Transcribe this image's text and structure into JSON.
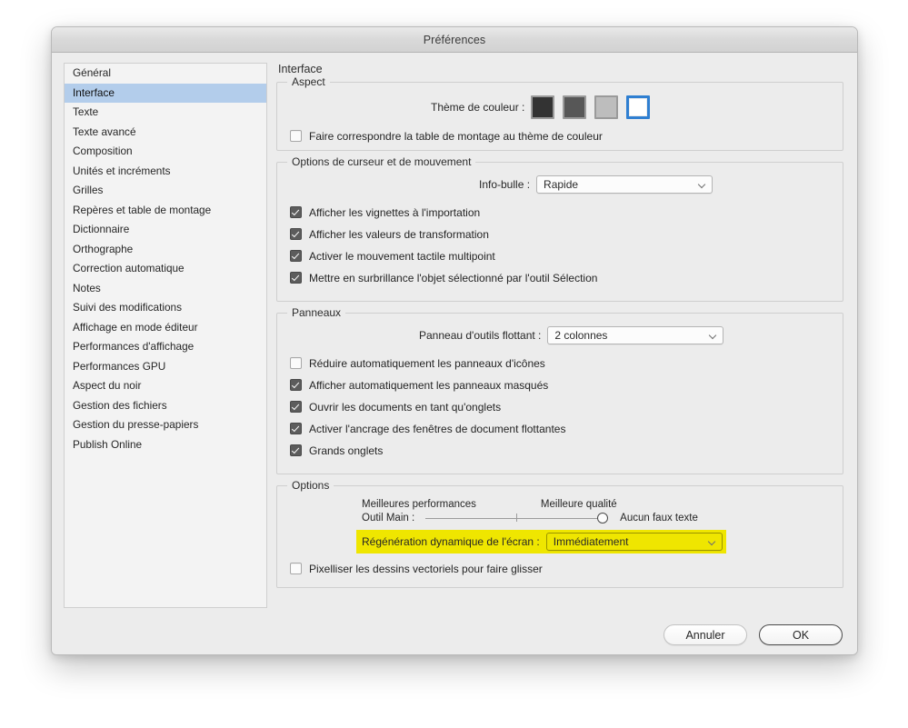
{
  "window": {
    "title": "Préférences"
  },
  "sidebar": {
    "items": [
      {
        "label": "Général",
        "selected": false
      },
      {
        "label": "Interface",
        "selected": true
      },
      {
        "label": "Texte",
        "selected": false
      },
      {
        "label": "Texte avancé",
        "selected": false
      },
      {
        "label": "Composition",
        "selected": false
      },
      {
        "label": "Unités et incréments",
        "selected": false
      },
      {
        "label": "Grilles",
        "selected": false
      },
      {
        "label": "Repères et table de montage",
        "selected": false
      },
      {
        "label": "Dictionnaire",
        "selected": false
      },
      {
        "label": "Orthographe",
        "selected": false
      },
      {
        "label": "Correction automatique",
        "selected": false
      },
      {
        "label": "Notes",
        "selected": false
      },
      {
        "label": "Suivi des modifications",
        "selected": false
      },
      {
        "label": "Affichage en mode éditeur",
        "selected": false
      },
      {
        "label": "Performances d'affichage",
        "selected": false
      },
      {
        "label": "Performances GPU",
        "selected": false
      },
      {
        "label": "Aspect du noir",
        "selected": false
      },
      {
        "label": "Gestion des fichiers",
        "selected": false
      },
      {
        "label": "Gestion du presse-papiers",
        "selected": false
      },
      {
        "label": "Publish Online",
        "selected": false
      }
    ]
  },
  "pane": {
    "title": "Interface",
    "aspect": {
      "legend": "Aspect",
      "theme_label": "Thème de couleur :",
      "swatches": [
        {
          "name": "dark-theme-swatch",
          "color": "#333333",
          "selected": false
        },
        {
          "name": "medium-dark-theme-swatch",
          "color": "#575757",
          "selected": false
        },
        {
          "name": "light-grey-theme-swatch",
          "color": "#bdbdbd",
          "selected": false
        },
        {
          "name": "light-theme-swatch",
          "color": "#ffffff",
          "selected": true
        }
      ],
      "match_pasteboard_label": "Faire correspondre la table de montage au thème de couleur",
      "match_pasteboard_checked": false
    },
    "cursor": {
      "legend": "Options de curseur et de mouvement",
      "tooltip_label": "Info-bulle :",
      "tooltip_value": "Rapide",
      "checkboxes": [
        {
          "label": "Afficher les vignettes à l'importation",
          "checked": true
        },
        {
          "label": "Afficher les valeurs de transformation",
          "checked": true
        },
        {
          "label": "Activer le mouvement tactile multipoint",
          "checked": true
        },
        {
          "label": "Mettre en surbrillance l'objet sélectionné par l'outil Sélection",
          "checked": true
        }
      ]
    },
    "panels": {
      "legend": "Panneaux",
      "toolbar_label": "Panneau d'outils flottant :",
      "toolbar_value": "2 colonnes",
      "checkboxes": [
        {
          "label": "Réduire automatiquement les panneaux d'icônes",
          "checked": false
        },
        {
          "label": "Afficher automatiquement les panneaux masqués",
          "checked": true
        },
        {
          "label": "Ouvrir les documents en tant qu'onglets",
          "checked": true
        },
        {
          "label": "Activer l'ancrage des fenêtres de document flottantes",
          "checked": true
        },
        {
          "label": "Grands onglets",
          "checked": true
        }
      ]
    },
    "options": {
      "legend": "Options",
      "slider_min_label": "Meilleures performances",
      "slider_max_label": "Meilleure qualité",
      "hand_tool_label": "Outil Main :",
      "hand_tool_value": "Aucun faux texte",
      "regen_label": "Régénération dynamique de l'écran :",
      "regen_value": "Immédiatement",
      "regen_highlight_color": "#efe600",
      "rasterize_label": "Pixelliser les dessins vectoriels pour faire glisser",
      "rasterize_checked": false
    }
  },
  "footer": {
    "cancel_label": "Annuler",
    "ok_label": "OK"
  }
}
